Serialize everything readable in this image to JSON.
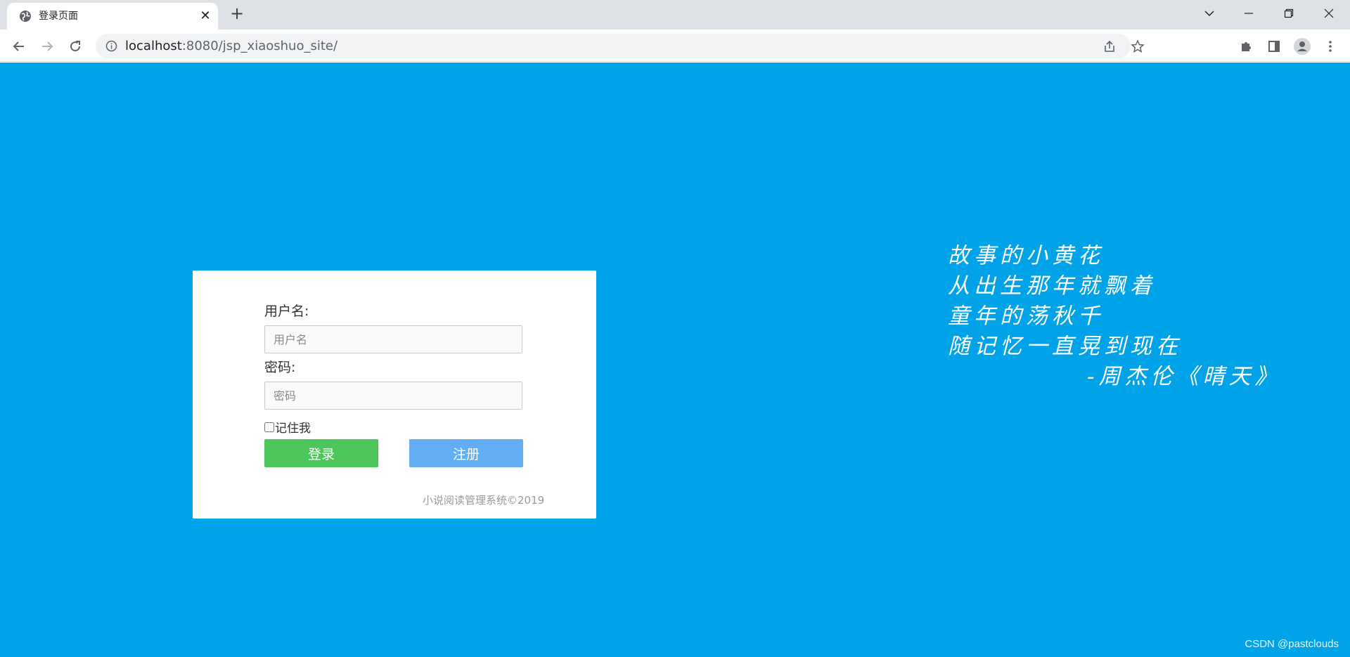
{
  "browser": {
    "tab_title": "登录页面",
    "url_host": "localhost",
    "url_rest": ":8080/jsp_xiaoshuo_site/",
    "icons": {
      "favicon": "globe-icon",
      "back": "back-arrow-icon",
      "forward": "forward-arrow-icon",
      "reload": "reload-icon",
      "info": "info-icon",
      "share": "share-icon",
      "bookmark": "star-icon",
      "extensions": "puzzle-icon",
      "sidepanel": "side-panel-icon",
      "profile": "profile-icon",
      "menu": "kebab-menu-icon"
    }
  },
  "login": {
    "username_label": "用户名:",
    "username_placeholder": "用户名",
    "password_label": "密码:",
    "password_placeholder": "密码",
    "remember_label": "记住我",
    "login_button": "登录",
    "register_button": "注册",
    "footer": "小说阅读管理系统©2019"
  },
  "quote": {
    "lines": [
      "故事的小黄花",
      "从出生那年就飘着",
      "童年的荡秋千",
      "随记忆一直晃到现在"
    ],
    "attribution": "-周杰伦《晴天》"
  },
  "watermark": "CSDN @pastclouds",
  "colors": {
    "background": "#00a3e8",
    "login_button": "#4cc55a",
    "register_button": "#63adf5"
  }
}
